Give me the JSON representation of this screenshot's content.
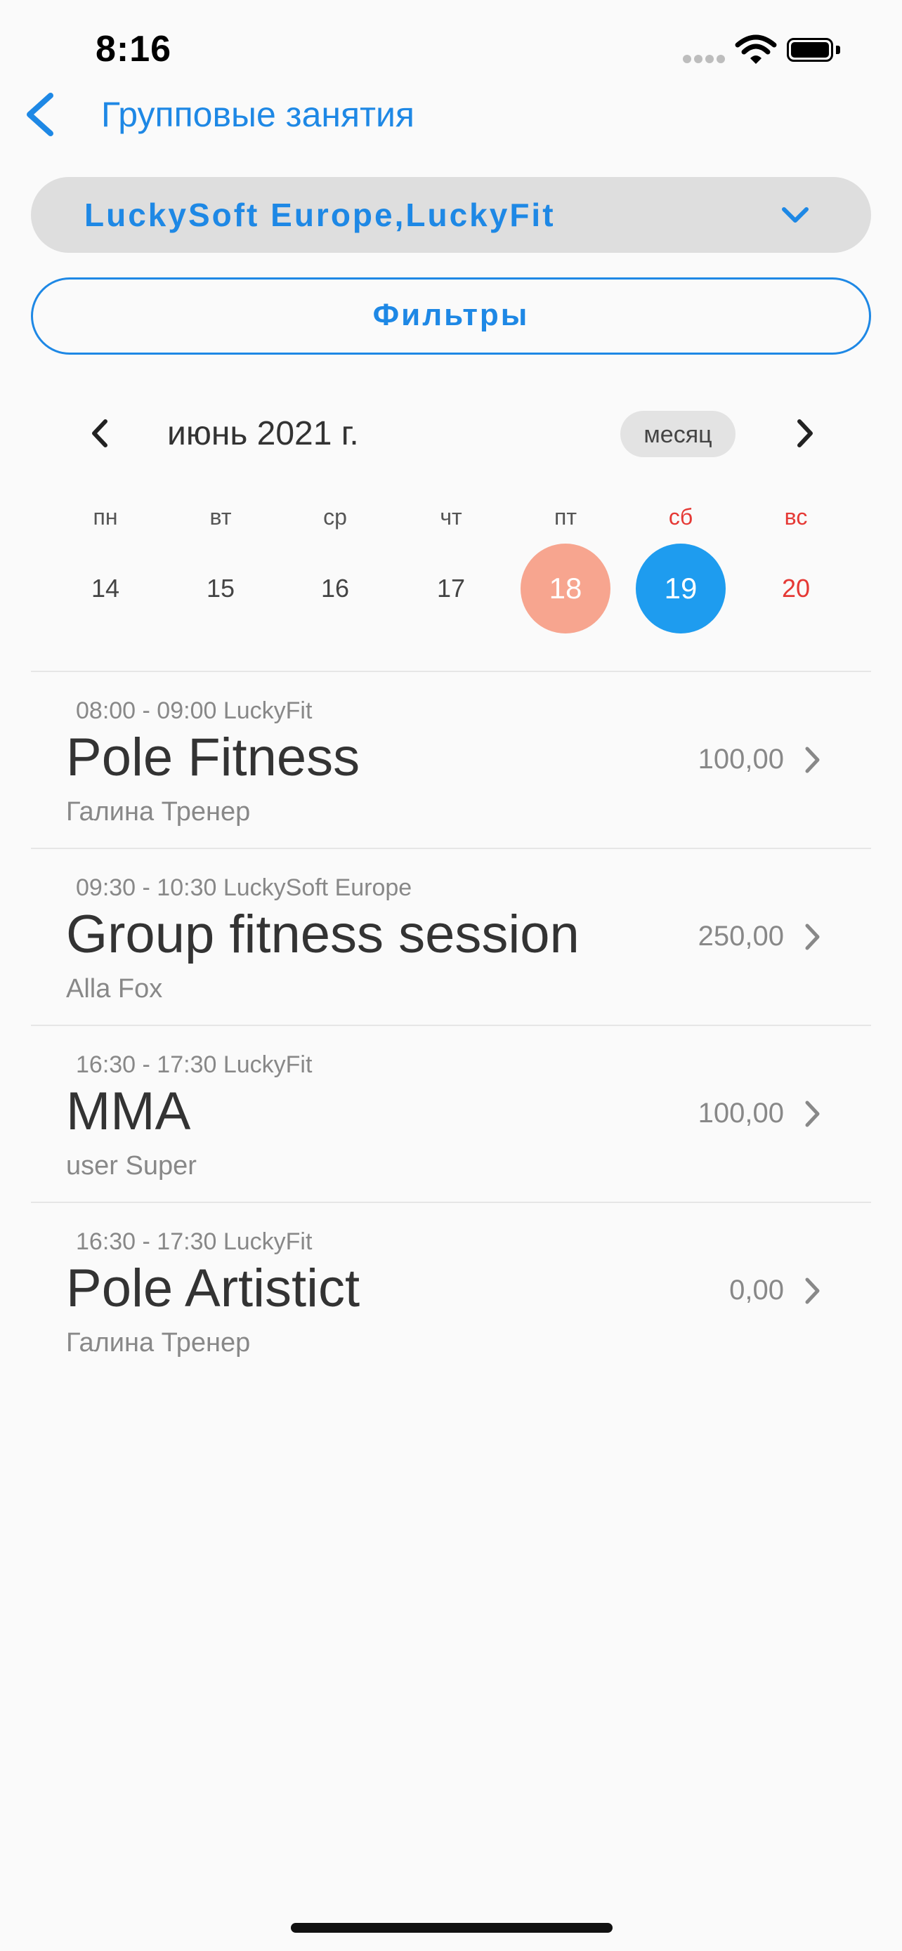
{
  "status_bar": {
    "time": "8:16"
  },
  "nav": {
    "title": "Групповые занятия"
  },
  "club_selector": {
    "value": "LuckySoft Europe,LuckyFit"
  },
  "filters": {
    "label": "Фильтры"
  },
  "calendar": {
    "month_label": "июнь 2021 г.",
    "view_mode": "месяц",
    "weekdays": [
      "пн",
      "вт",
      "ср",
      "чт",
      "пт",
      "сб",
      "вс"
    ],
    "days": [
      "14",
      "15",
      "16",
      "17",
      "18",
      "19",
      "20"
    ],
    "today": "18",
    "selected": "19"
  },
  "sessions": [
    {
      "meta": "08:00 - 09:00 LuckyFit",
      "name": "Pole Fitness",
      "trainer": "Галина Тренер",
      "price": "100,00"
    },
    {
      "meta": "09:30 - 10:30 LuckySoft Europe",
      "name": "Group fitness session",
      "trainer": "Alla Fox",
      "price": "250,00"
    },
    {
      "meta": "16:30 - 17:30 LuckyFit",
      "name": "MMA",
      "trainer": "user Super",
      "price": "100,00"
    },
    {
      "meta": "16:30 - 17:30 LuckyFit",
      "name": "Pole Artistict",
      "trainer": "Галина Тренер",
      "price": "0,00"
    }
  ],
  "colors": {
    "accent": "#1e88e5",
    "selected_day": "#1e9cef",
    "today_day": "#f7a58f",
    "weekend": "#e53935"
  }
}
